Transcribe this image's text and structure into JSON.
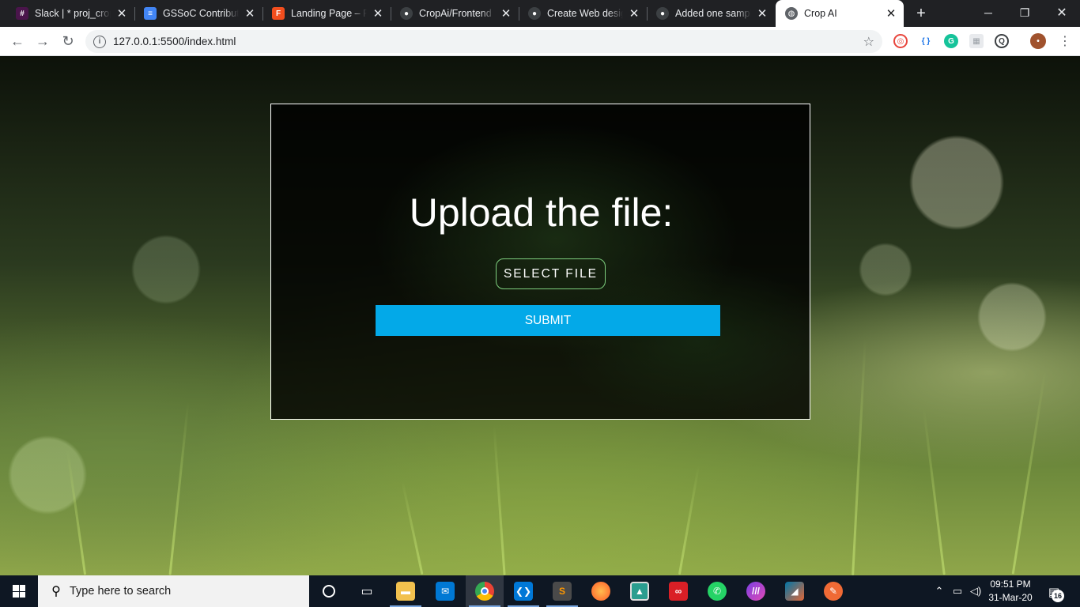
{
  "browser": {
    "tabs": [
      {
        "title": "Slack | * proj_crop",
        "icon": "slack-icon",
        "icon_color": "#4a154b",
        "active": false
      },
      {
        "title": "GSSoC Contribution",
        "icon": "google-docs-icon",
        "icon_color": "#4285f4",
        "active": false
      },
      {
        "title": "Landing Page – Figma",
        "icon": "figma-icon",
        "icon_color": "#f24e1e",
        "active": false
      },
      {
        "title": "CropAi/Frontend",
        "icon": "github-icon",
        "icon_color": "#3c4043",
        "active": false
      },
      {
        "title": "Create Web design",
        "icon": "github-icon",
        "icon_color": "#3c4043",
        "active": false
      },
      {
        "title": "Added one sample",
        "icon": "github-icon",
        "icon_color": "#3c4043",
        "active": false
      },
      {
        "title": "Crop AI",
        "icon": "globe-icon",
        "icon_color": "#5f6368",
        "active": true
      }
    ],
    "url": "127.0.0.1:5500/index.html"
  },
  "page": {
    "heading": "Upload the file:",
    "select_file_label": "SELECT FILE",
    "submit_label": "SUBMIT",
    "colors": {
      "submit_bg": "#03a9e8",
      "select_border": "#7ecf7e",
      "card_border": "#ffffff"
    }
  },
  "taskbar": {
    "search_placeholder": "Type here to search",
    "apps": [
      "cortana-icon",
      "task-view-icon",
      "file-explorer-icon",
      "mail-icon",
      "chrome-icon",
      "vscode-icon",
      "sublime-icon",
      "firefox-icon",
      "photos-icon",
      "creative-cloud-icon",
      "whatsapp-icon",
      "app-icon",
      "matlab-icon",
      "app-icon"
    ],
    "time": "09:51 PM",
    "date": "31-Mar-20",
    "notification_count": "16"
  }
}
